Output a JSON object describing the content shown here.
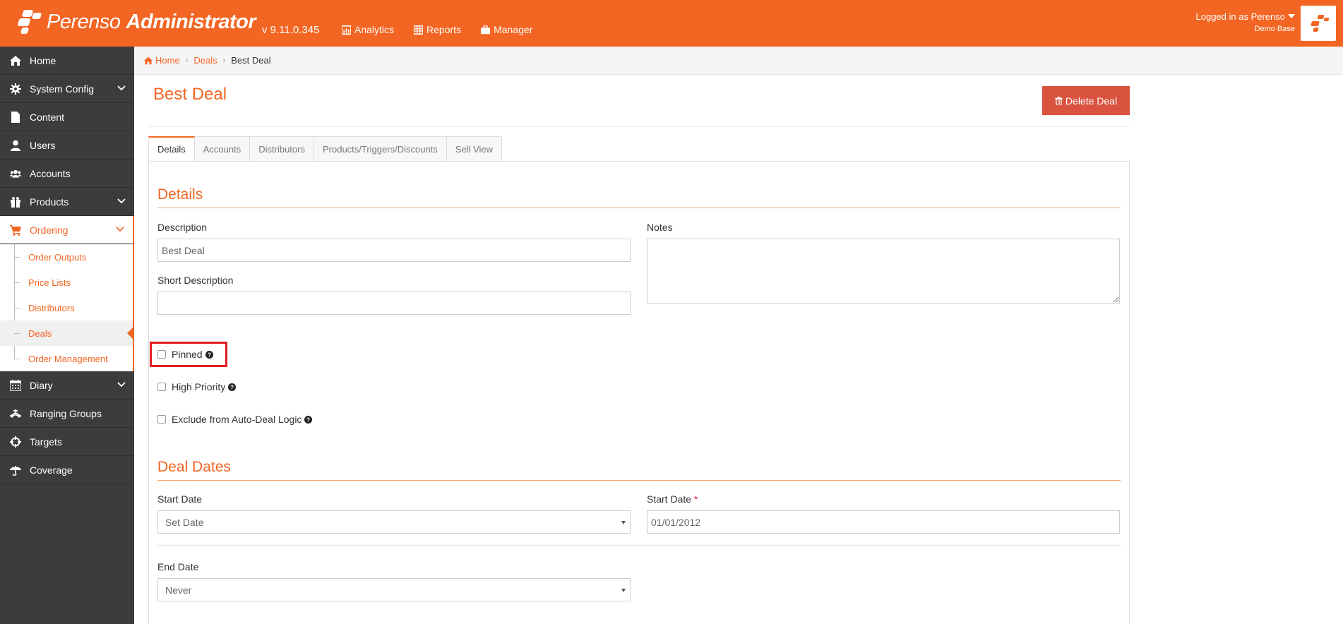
{
  "header": {
    "brand_name": "Perenso",
    "brand_suffix": "Administrator",
    "version": "v 9.11.0.345",
    "nav": [
      {
        "label": "Analytics",
        "icon": "chart-icon"
      },
      {
        "label": "Reports",
        "icon": "table-icon"
      },
      {
        "label": "Manager",
        "icon": "briefcase-icon"
      }
    ],
    "logged_in": "Logged in as Perenso",
    "base": "Demo Base"
  },
  "sidebar": {
    "items": [
      {
        "label": "Home",
        "icon": "home-icon"
      },
      {
        "label": "System Config",
        "icon": "gear-icon"
      },
      {
        "label": "Content",
        "icon": "file-icon"
      },
      {
        "label": "Users",
        "icon": "user-icon"
      },
      {
        "label": "Accounts",
        "icon": "users-icon"
      },
      {
        "label": "Products",
        "icon": "gift-icon"
      },
      {
        "label": "Ordering",
        "icon": "cart-icon"
      },
      {
        "label": "Diary",
        "icon": "calendar-icon"
      },
      {
        "label": "Ranging Groups",
        "icon": "cubes-icon"
      },
      {
        "label": "Targets",
        "icon": "crosshairs-icon"
      },
      {
        "label": "Coverage",
        "icon": "umbrella-icon"
      }
    ],
    "ordering_sub": [
      {
        "label": "Order Outputs"
      },
      {
        "label": "Price Lists"
      },
      {
        "label": "Distributors"
      },
      {
        "label": "Deals"
      },
      {
        "label": "Order Management"
      }
    ]
  },
  "breadcrumb": {
    "home": "Home",
    "deals": "Deals",
    "current": "Best Deal"
  },
  "page": {
    "title": "Best Deal",
    "delete_label": "Delete Deal"
  },
  "tabs": [
    {
      "label": "Details"
    },
    {
      "label": "Accounts"
    },
    {
      "label": "Distributors"
    },
    {
      "label": "Products/Triggers/Discounts"
    },
    {
      "label": "Sell View"
    }
  ],
  "details": {
    "section_title": "Details",
    "description_label": "Description",
    "description_value": "Best Deal",
    "notes_label": "Notes",
    "short_description_label": "Short Description",
    "short_description_value": "",
    "pinned_label": "Pinned",
    "high_priority_label": "High Priority",
    "exclude_label": "Exclude from Auto-Deal Logic"
  },
  "deal_dates": {
    "section_title": "Deal Dates",
    "start_date_label": "Start Date",
    "start_date_select": "Set Date",
    "start_date_label_2": "Start Date",
    "required_mark": "*",
    "start_date_value": "01/01/2012",
    "end_date_label": "End Date",
    "end_date_select": "Never"
  },
  "colors": {
    "brand": "#f26522",
    "danger": "#d9533f",
    "sidebar": "#3c3c3c",
    "highlight": "#e31c23"
  }
}
